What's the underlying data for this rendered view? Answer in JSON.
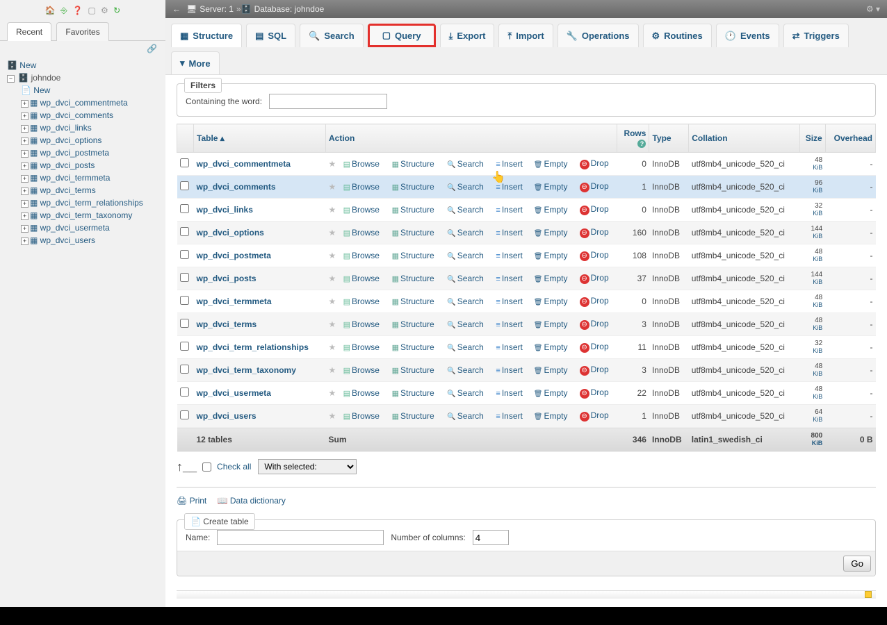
{
  "breadcrumb": {
    "server_label": "Server: 1",
    "db_label": "Database: johndoe"
  },
  "sidebar": {
    "tabs": {
      "recent": "Recent",
      "favorites": "Favorites"
    },
    "new_label": "New",
    "db_name": "johndoe",
    "tree_new_label": "New",
    "tables": [
      "wp_dvci_commentmeta",
      "wp_dvci_comments",
      "wp_dvci_links",
      "wp_dvci_options",
      "wp_dvci_postmeta",
      "wp_dvci_posts",
      "wp_dvci_termmeta",
      "wp_dvci_terms",
      "wp_dvci_term_relationships",
      "wp_dvci_term_taxonomy",
      "wp_dvci_usermeta",
      "wp_dvci_users"
    ]
  },
  "tabs": {
    "structure": "Structure",
    "sql": "SQL",
    "search": "Search",
    "query": "Query",
    "export": "Export",
    "import": "Import",
    "operations": "Operations",
    "routines": "Routines",
    "events": "Events",
    "triggers": "Triggers",
    "more": "More"
  },
  "filters": {
    "legend": "Filters",
    "label": "Containing the word:",
    "value": ""
  },
  "headers": {
    "table": "Table",
    "action": "Action",
    "rows": "Rows",
    "type": "Type",
    "collation": "Collation",
    "size": "Size",
    "overhead": "Overhead"
  },
  "actions": {
    "browse": "Browse",
    "structure": "Structure",
    "search": "Search",
    "insert": "Insert",
    "empty": "Empty",
    "drop": "Drop"
  },
  "rows": [
    {
      "name": "wp_dvci_commentmeta",
      "rows": "0",
      "type": "InnoDB",
      "collation": "utf8mb4_unicode_520_ci",
      "size": "48",
      "unit": "KiB",
      "overhead": "-"
    },
    {
      "name": "wp_dvci_comments",
      "rows": "1",
      "type": "InnoDB",
      "collation": "utf8mb4_unicode_520_ci",
      "size": "96",
      "unit": "KiB",
      "overhead": "-"
    },
    {
      "name": "wp_dvci_links",
      "rows": "0",
      "type": "InnoDB",
      "collation": "utf8mb4_unicode_520_ci",
      "size": "32",
      "unit": "KiB",
      "overhead": "-"
    },
    {
      "name": "wp_dvci_options",
      "rows": "160",
      "type": "InnoDB",
      "collation": "utf8mb4_unicode_520_ci",
      "size": "144",
      "unit": "KiB",
      "overhead": "-"
    },
    {
      "name": "wp_dvci_postmeta",
      "rows": "108",
      "type": "InnoDB",
      "collation": "utf8mb4_unicode_520_ci",
      "size": "48",
      "unit": "KiB",
      "overhead": "-"
    },
    {
      "name": "wp_dvci_posts",
      "rows": "37",
      "type": "InnoDB",
      "collation": "utf8mb4_unicode_520_ci",
      "size": "144",
      "unit": "KiB",
      "overhead": "-"
    },
    {
      "name": "wp_dvci_termmeta",
      "rows": "0",
      "type": "InnoDB",
      "collation": "utf8mb4_unicode_520_ci",
      "size": "48",
      "unit": "KiB",
      "overhead": "-"
    },
    {
      "name": "wp_dvci_terms",
      "rows": "3",
      "type": "InnoDB",
      "collation": "utf8mb4_unicode_520_ci",
      "size": "48",
      "unit": "KiB",
      "overhead": "-"
    },
    {
      "name": "wp_dvci_term_relationships",
      "rows": "11",
      "type": "InnoDB",
      "collation": "utf8mb4_unicode_520_ci",
      "size": "32",
      "unit": "KiB",
      "overhead": "-"
    },
    {
      "name": "wp_dvci_term_taxonomy",
      "rows": "3",
      "type": "InnoDB",
      "collation": "utf8mb4_unicode_520_ci",
      "size": "48",
      "unit": "KiB",
      "overhead": "-"
    },
    {
      "name": "wp_dvci_usermeta",
      "rows": "22",
      "type": "InnoDB",
      "collation": "utf8mb4_unicode_520_ci",
      "size": "48",
      "unit": "KiB",
      "overhead": "-"
    },
    {
      "name": "wp_dvci_users",
      "rows": "1",
      "type": "InnoDB",
      "collation": "utf8mb4_unicode_520_ci",
      "size": "64",
      "unit": "KiB",
      "overhead": "-"
    }
  ],
  "summary": {
    "count": "12 tables",
    "sum": "Sum",
    "rows": "346",
    "type": "InnoDB",
    "collation": "latin1_swedish_ci",
    "size": "800",
    "unit": "KiB",
    "overhead": "0 B"
  },
  "check_all": {
    "label": "Check all",
    "with_selected": "With selected:"
  },
  "links": {
    "print": "Print",
    "data_dict": "Data dictionary"
  },
  "create_table": {
    "legend": "Create table",
    "name_label": "Name:",
    "name_value": "",
    "cols_label": "Number of columns:",
    "cols_value": "4",
    "go": "Go"
  }
}
